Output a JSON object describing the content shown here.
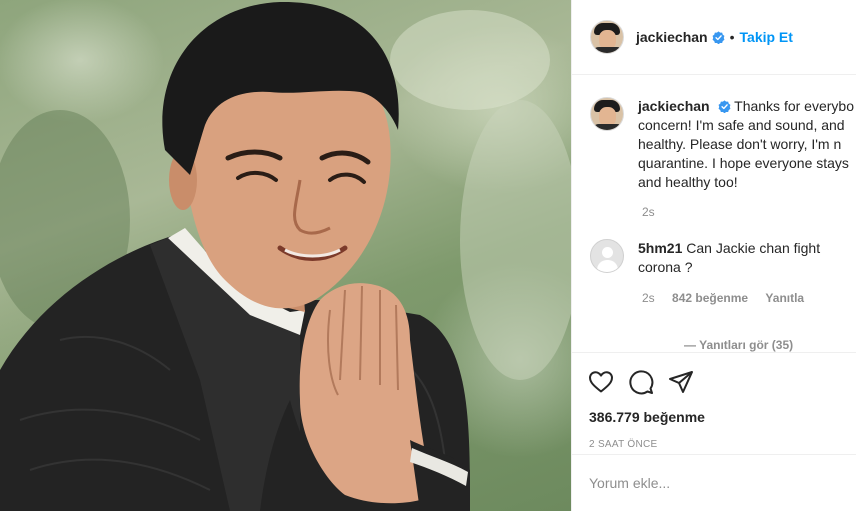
{
  "post": {
    "username": "jackiechan",
    "follow_label": "Takip Et",
    "dot": "•"
  },
  "comments": [
    {
      "username": "jackiechan",
      "lines": [
        "Thanks for everybo",
        "concern! I'm safe and sound, and",
        "healthy. Please don't worry, I'm n",
        "quarantine. I hope everyone stays",
        "and healthy too!"
      ],
      "time": "2s"
    },
    {
      "username": "5hm21",
      "lines": [
        "Can Jackie chan fight",
        "corona ?"
      ],
      "time": "2s",
      "likes": "842 beğenme",
      "reply": "Yanıtla"
    }
  ],
  "view_replies": "— Yanıtları gör (35)",
  "likes_count": "386.779 beğenme",
  "posted_time": "2 SAAT ÖNCE",
  "comment_input": {
    "placeholder": "Yorum ekle..."
  },
  "colors": {
    "accent": "#0095f6",
    "muted": "#8e8e8e",
    "text": "#262626"
  },
  "icons": [
    "heart-icon",
    "comment-icon",
    "share-icon",
    "verified-badge-icon"
  ]
}
